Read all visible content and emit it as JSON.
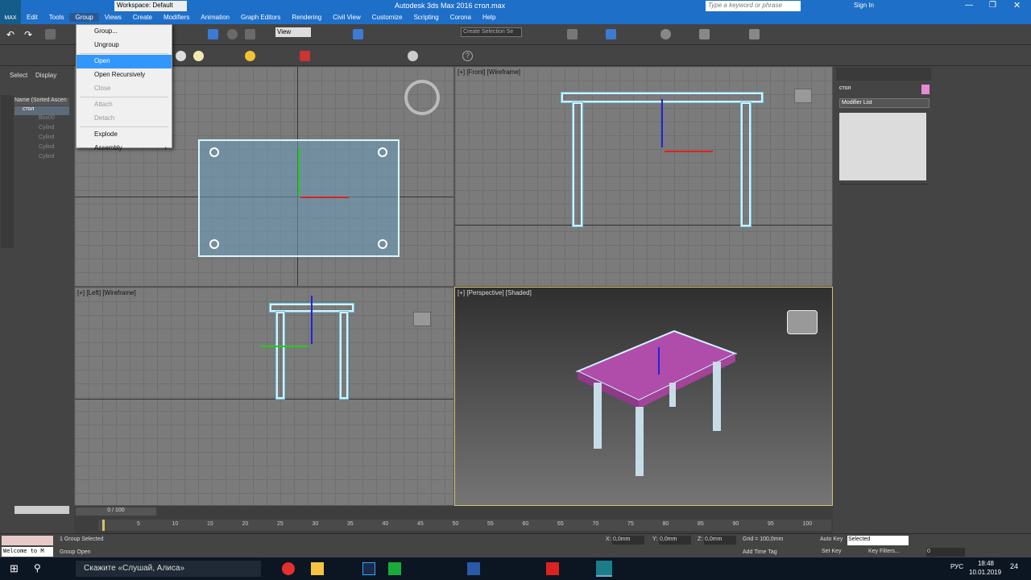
{
  "app": {
    "logo_text": "MAX",
    "title": "Autodesk 3ds Max 2016      стол.max",
    "workspace": "Workspace: Default",
    "search_placeholder": "Type a keyword or phrase",
    "sign_in": "Sign In"
  },
  "menubar": [
    "Edit",
    "Tools",
    "Group",
    "Views",
    "Create",
    "Modifiers",
    "Animation",
    "Graph Editors",
    "Rendering",
    "Civil View",
    "Customize",
    "Scripting",
    "Corona",
    "Help"
  ],
  "group_menu": {
    "items": [
      "Group...",
      "Ungroup",
      "Open",
      "Open Recursively",
      "Close",
      "Attach",
      "Detach",
      "Explode",
      "Assembly"
    ],
    "highlighted": "Open",
    "disabled": [
      "Close",
      "Attach",
      "Detach"
    ],
    "submenu_arrow": "›"
  },
  "toolbar": {
    "view_dropdown": "View",
    "selection_set": "Create Selection Se"
  },
  "left_panel": {
    "tabs": [
      "Select",
      "Display"
    ],
    "header": "Name (Sorted Ascen",
    "root": "стол",
    "children": [
      "Box00",
      "Cylind",
      "Cylind",
      "Cylind",
      "Cylind"
    ]
  },
  "viewports": {
    "top_label": "",
    "front_label": "[+] [Front] [Wireframe]",
    "left_label": "[+] [Left] [Wireframe]",
    "persp_label": "[+] [Perspective] [Shaded]"
  },
  "right_panel": {
    "object_name": "стол",
    "modifier_list": "Modifier List"
  },
  "timeline": {
    "frame": "0 / 100",
    "ticks": [
      "5",
      "10",
      "15",
      "20",
      "25",
      "30",
      "35",
      "40",
      "45",
      "50",
      "55",
      "60",
      "65",
      "70",
      "75",
      "80",
      "85",
      "90",
      "95",
      "100"
    ]
  },
  "status": {
    "selected": "1 Group Selected",
    "prompt": "Group Open",
    "welcome": "Welcome to M",
    "x_label": "X:",
    "x": "0,0mm",
    "y_label": "Y:",
    "y": "0,0mm",
    "z_label": "Z:",
    "z": "0,0mm",
    "grid": "Grid = 100,0mm",
    "add_time_tag": "Add Time Tag",
    "auto_key": "Auto Key",
    "set_key": "Set Key",
    "selected_dropdown": "Selected",
    "key_filters": "Key Filters...",
    "frame_field": "0"
  },
  "taskbar": {
    "search": "Скажите «Слушай, Алиса»",
    "lang": "РУС",
    "time": "18:48",
    "date": "10.01.2019",
    "notify": "24"
  },
  "colors": {
    "accent": "#1e6fc8",
    "tabletop": "#b04ca9",
    "wire": "#cff4ff"
  }
}
